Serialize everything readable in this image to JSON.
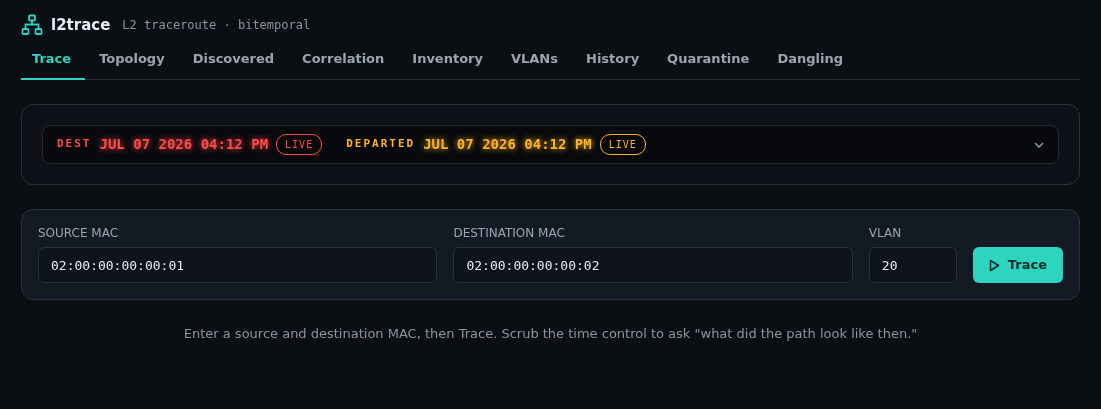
{
  "app": {
    "title": "l2trace",
    "subtitle": "L2 traceroute · bitemporal"
  },
  "tabs": [
    {
      "label": "Trace",
      "selected": true
    },
    {
      "label": "Topology",
      "selected": false
    },
    {
      "label": "Discovered",
      "selected": false
    },
    {
      "label": "Correlation",
      "selected": false
    },
    {
      "label": "Inventory",
      "selected": false
    },
    {
      "label": "VLANs",
      "selected": false
    },
    {
      "label": "History",
      "selected": false
    },
    {
      "label": "Quarantine",
      "selected": false
    },
    {
      "label": "Dangling",
      "selected": false
    }
  ],
  "time_bar": {
    "expanded": false,
    "clocks": [
      {
        "label": "DEST",
        "time": "JUL 07 2026 04:12 PM",
        "badge": "LIVE",
        "color": "#ff4b4b"
      },
      {
        "label": "DEPARTED",
        "time": "JUL 07 2026 04:12 PM",
        "badge": "LIVE",
        "color": "#ffb224"
      }
    ]
  },
  "form": {
    "fields": [
      {
        "label": "SOURCE MAC",
        "value": "02:00:00:00:00:01",
        "kind": "mac"
      },
      {
        "label": "DESTINATION MAC",
        "value": "02:00:00:00:00:02",
        "kind": "mac"
      },
      {
        "label": "VLAN",
        "value": "20",
        "kind": "number"
      }
    ],
    "button": "Trace"
  },
  "help_text": "Enter a source and destination MAC, then Trace. Scrub the time control to ask \"what did the path look like then.\""
}
